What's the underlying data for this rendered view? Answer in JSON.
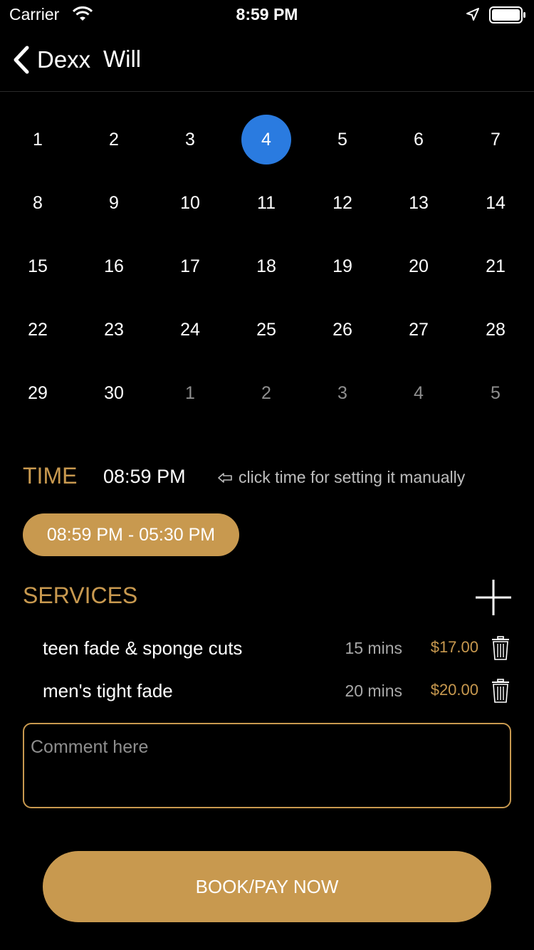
{
  "status_bar": {
    "carrier": "Carrier",
    "time": "8:59 PM"
  },
  "nav": {
    "back_label": "Dexx",
    "title": "Will"
  },
  "calendar": {
    "selected_day": "4",
    "weeks": [
      [
        {
          "d": "1",
          "muted": false
        },
        {
          "d": "2",
          "muted": false
        },
        {
          "d": "3",
          "muted": false
        },
        {
          "d": "4",
          "muted": false
        },
        {
          "d": "5",
          "muted": false
        },
        {
          "d": "6",
          "muted": false
        },
        {
          "d": "7",
          "muted": false
        }
      ],
      [
        {
          "d": "8",
          "muted": false
        },
        {
          "d": "9",
          "muted": false
        },
        {
          "d": "10",
          "muted": false
        },
        {
          "d": "11",
          "muted": false
        },
        {
          "d": "12",
          "muted": false
        },
        {
          "d": "13",
          "muted": false
        },
        {
          "d": "14",
          "muted": false
        }
      ],
      [
        {
          "d": "15",
          "muted": false
        },
        {
          "d": "16",
          "muted": false
        },
        {
          "d": "17",
          "muted": false
        },
        {
          "d": "18",
          "muted": false
        },
        {
          "d": "19",
          "muted": false
        },
        {
          "d": "20",
          "muted": false
        },
        {
          "d": "21",
          "muted": false
        }
      ],
      [
        {
          "d": "22",
          "muted": false
        },
        {
          "d": "23",
          "muted": false
        },
        {
          "d": "24",
          "muted": false
        },
        {
          "d": "25",
          "muted": false
        },
        {
          "d": "26",
          "muted": false
        },
        {
          "d": "27",
          "muted": false
        },
        {
          "d": "28",
          "muted": false
        }
      ],
      [
        {
          "d": "29",
          "muted": false
        },
        {
          "d": "30",
          "muted": false
        },
        {
          "d": "1",
          "muted": true
        },
        {
          "d": "2",
          "muted": true
        },
        {
          "d": "3",
          "muted": true
        },
        {
          "d": "4",
          "muted": true
        },
        {
          "d": "5",
          "muted": true
        }
      ]
    ]
  },
  "time": {
    "label": "TIME",
    "value": "08:59 PM",
    "hint": "click time for setting it manually",
    "slot": "08:59 PM - 05:30 PM"
  },
  "services": {
    "label": "SERVICES",
    "items": [
      {
        "name": "teen fade & sponge  cuts",
        "duration": "15 mins",
        "price": "$17.00"
      },
      {
        "name": "men's tight fade",
        "duration": "20 mins",
        "price": "$20.00"
      }
    ]
  },
  "comment": {
    "placeholder": "Comment here",
    "value": ""
  },
  "book_button": {
    "label": "BOOK/PAY NOW"
  },
  "colors": {
    "accent": "#c8994f",
    "selected": "#2a7be0",
    "background": "#000000"
  },
  "icons": [
    "wifi-icon",
    "location-arrow-icon",
    "battery-icon",
    "chevron-left-icon",
    "arrow-left-outline-icon",
    "plus-icon",
    "trash-icon"
  ]
}
